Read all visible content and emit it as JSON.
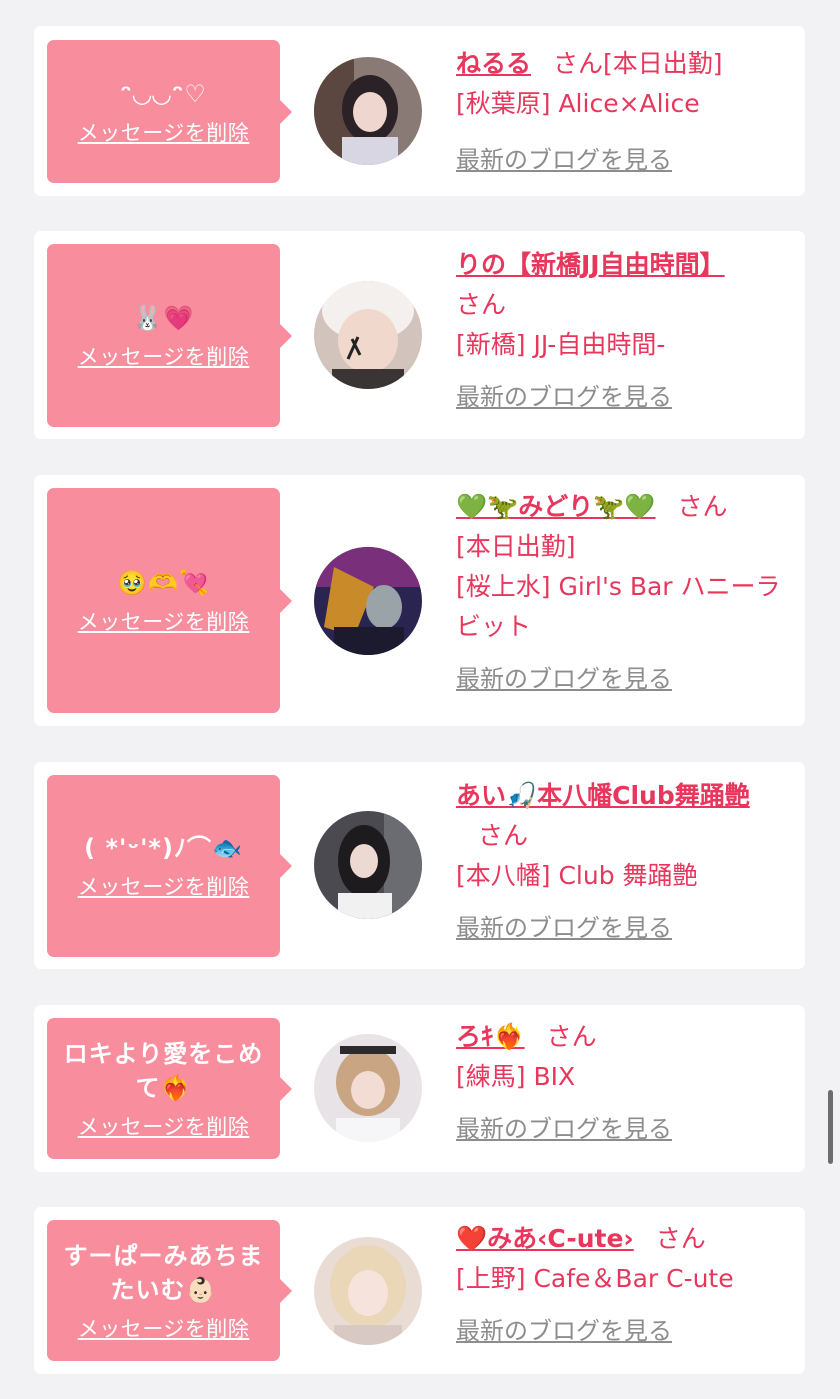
{
  "delete_label": "メッセージを削除",
  "blog_label": "最新のブログを見る",
  "colors": {
    "background": "#f2f2f4",
    "bubble": "#f78d9d",
    "accent": "#e8365c",
    "link_gray": "#8d8d8d"
  },
  "cards": [
    {
      "message": "ᵔ◡◡ᵔ♡",
      "name": "ねるる",
      "san": "さん",
      "details": [
        "[本日出勤]",
        "[秋葉原] Alice×Alice"
      ]
    },
    {
      "message": "🐰💗",
      "name": "りの【新橋JJ自由時間】",
      "san": "さん",
      "details": [
        "[新橋] JJ-自由時間-"
      ]
    },
    {
      "message": "🥹🫶💘",
      "name": "💚🦖みどり🦖💚",
      "san": "さん",
      "details": [
        "[本日出勤]",
        "[桜上水] Girl's Bar ハニーラビット"
      ]
    },
    {
      "message": "( *'ᵕ'*)ﾉ⌒🐟",
      "name": "あい🎣本八幡Club舞踊艶",
      "san": "さん",
      "details": [
        "[本八幡] Club 舞踊艶"
      ]
    },
    {
      "message": "ロキより愛をこめて❤️‍🔥",
      "name": "ろｷ❤️‍🔥",
      "san": "さん",
      "details": [
        "[練馬] BIX"
      ]
    },
    {
      "message": "すーぱーみあちまたいむ👶🏻",
      "name": "❤️みあ‹C-ute›",
      "san": "さん",
      "details": [
        "[上野] Cafe＆Bar C-ute"
      ]
    }
  ]
}
